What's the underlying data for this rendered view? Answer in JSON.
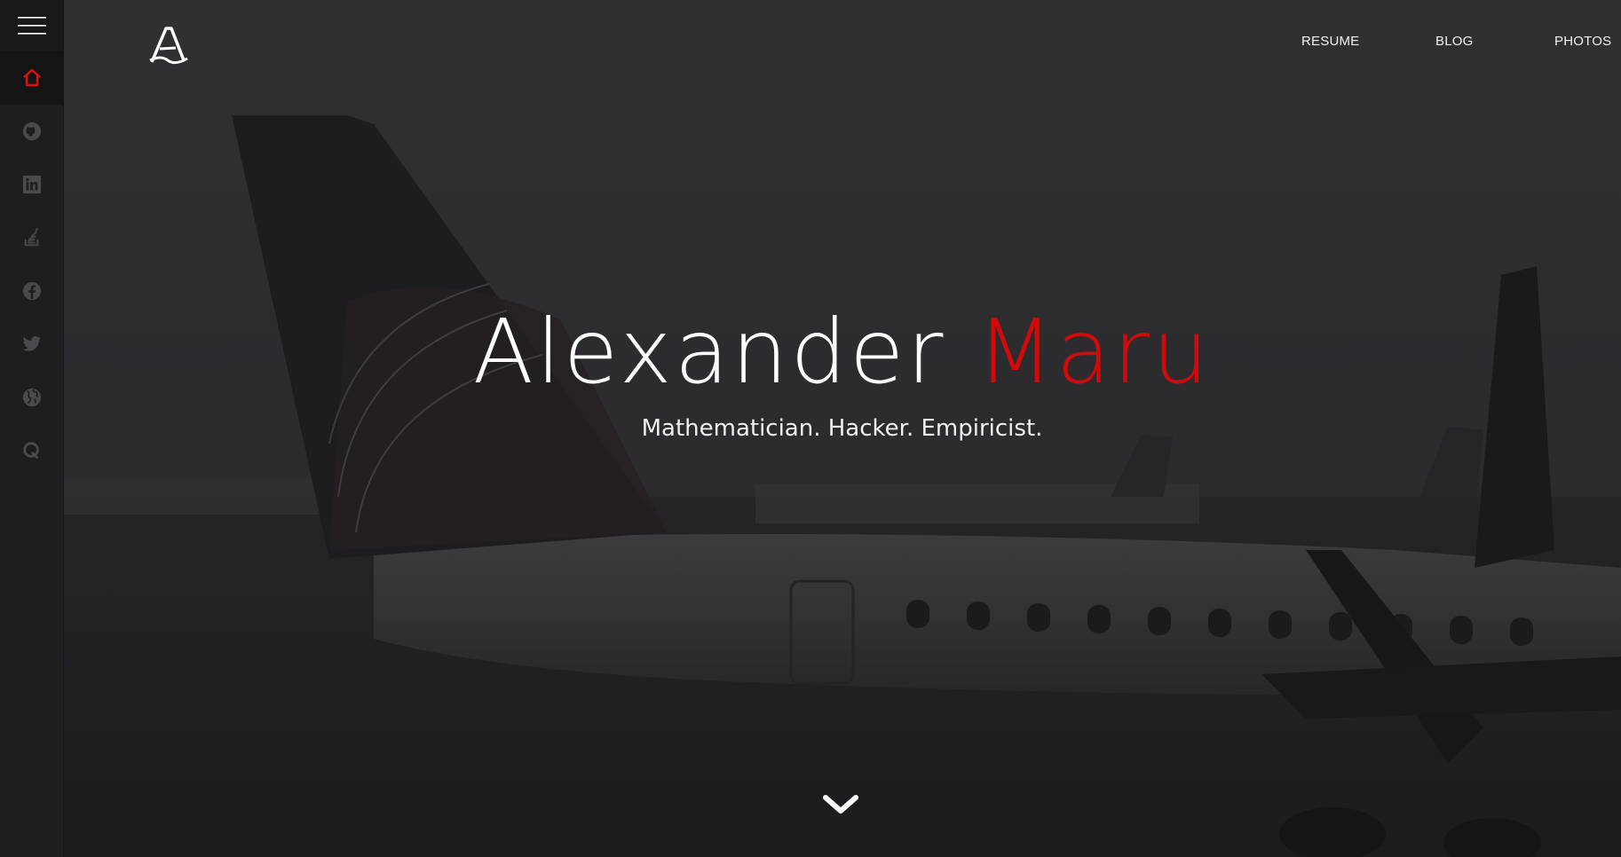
{
  "sidebar": {
    "menu_icon": "hamburger-menu-icon",
    "items": [
      {
        "icon": "home-icon",
        "active": true,
        "color": "#e01010"
      },
      {
        "icon": "github-icon",
        "active": false
      },
      {
        "icon": "linkedin-icon",
        "active": false
      },
      {
        "icon": "stackoverflow-icon",
        "active": false
      },
      {
        "icon": "facebook-icon",
        "active": false
      },
      {
        "icon": "twitter-icon",
        "active": false
      },
      {
        "icon": "globe-icon",
        "active": false
      },
      {
        "icon": "quora-icon",
        "active": false
      }
    ]
  },
  "header": {
    "logo_icon": "logo-a-icon",
    "nav": [
      {
        "label": "RESUME"
      },
      {
        "label": "BLOG"
      },
      {
        "label": "PHOTOS"
      }
    ]
  },
  "hero": {
    "first_name": "Alexander",
    "last_name": "Maru",
    "tagline": "Mathematician. Hacker. Empiricist.",
    "scroll_icon": "chevron-down-icon"
  },
  "colors": {
    "accent": "#d20a0a",
    "sidebar_bg": "#1e1e1f",
    "text": "#ffffff",
    "icon_muted": "#4a4a4c"
  }
}
